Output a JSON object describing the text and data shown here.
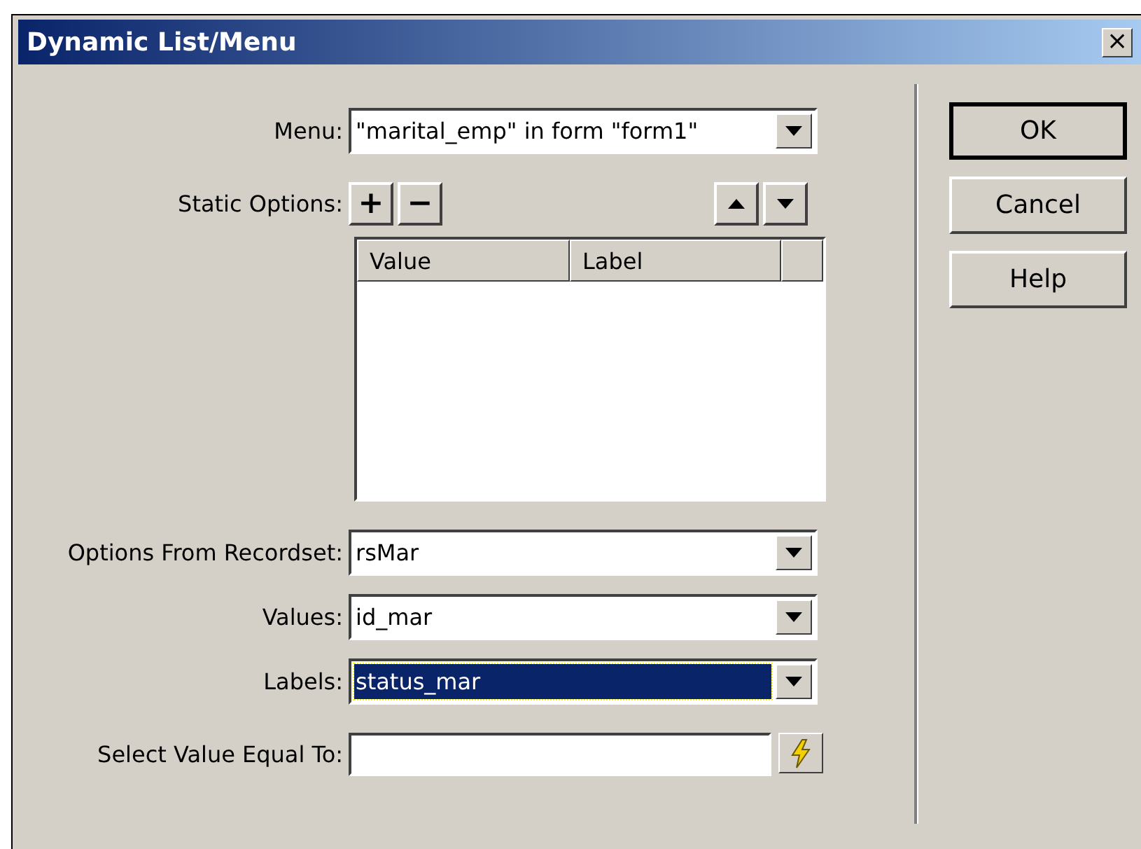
{
  "window": {
    "title": "Dynamic List/Menu",
    "close": "×"
  },
  "menu": {
    "label": "Menu:",
    "value": "\"marital_emp\" in form \"form1\""
  },
  "static_options": {
    "label": "Static Options:",
    "add": "+",
    "remove": "−",
    "columns": [
      "Value",
      "Label"
    ]
  },
  "selects": [
    {
      "label": "Options From Recordset:",
      "value": "rsMar",
      "selected": false
    },
    {
      "label": "Values:",
      "value": "id_mar",
      "selected": false
    },
    {
      "label": "Labels:",
      "value": "status_mar",
      "selected": true
    }
  ],
  "select_value": {
    "label": "Select Value Equal To:"
  },
  "buttons": [
    {
      "label": "OK",
      "default": true
    },
    {
      "label": "Cancel",
      "default": false
    },
    {
      "label": "Help",
      "default": false
    }
  ]
}
